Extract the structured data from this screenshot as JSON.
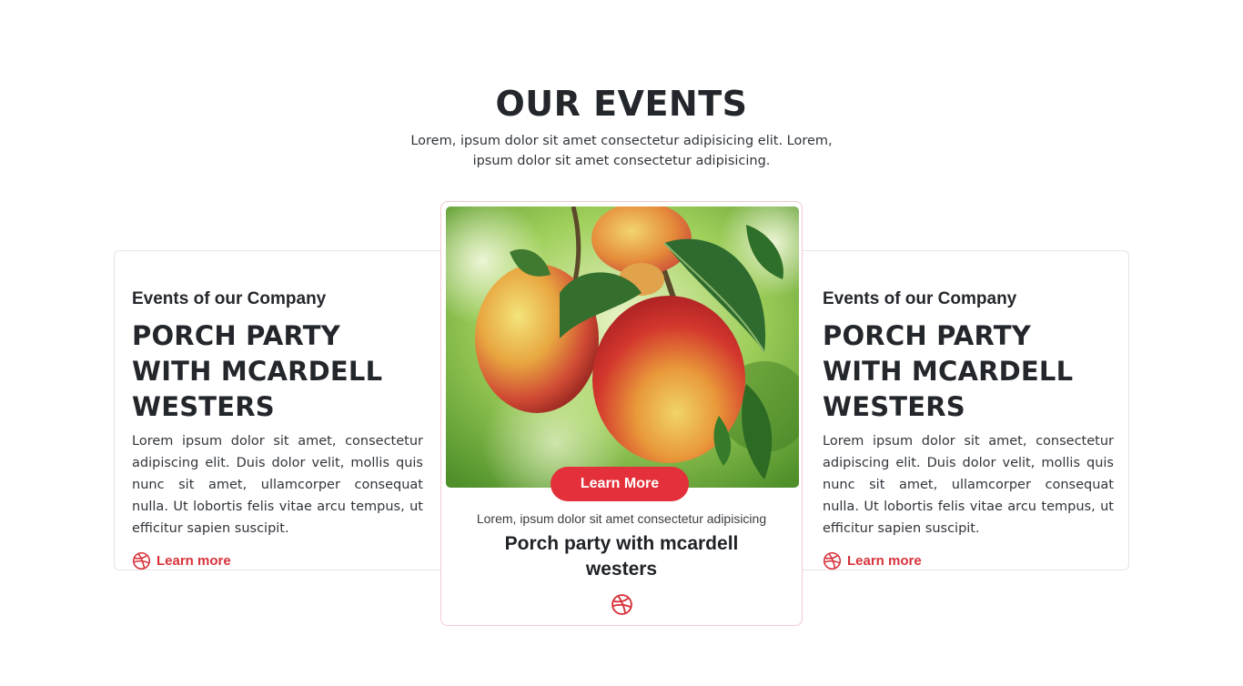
{
  "section": {
    "title": "OUR EVENTS",
    "subtitle": "Lorem, ipsum dolor sit amet consectetur adipisicing elit. Lorem, ipsum dolor sit amet consectetur adipisicing."
  },
  "left_card": {
    "kicker": "Events of our Company",
    "title": "PORCH PARTY WITH MCARDELL WESTERS",
    "description": "Lorem ipsum dolor sit amet, consectetur adipiscing elit. Duis dolor velit, mollis quis nunc sit amet, ullamcorper consequat nulla. Ut lobortis felis vitae arcu tempus, ut efficitur sapien suscipit.",
    "link_label": "Learn more",
    "link_icon": "dribbble-icon"
  },
  "center_card": {
    "image": "apples-on-branch",
    "button_label": "Learn More",
    "caption": "Lorem, ipsum dolor sit amet consectetur adipisicing",
    "title": "Porch party with mcardell westers",
    "icon": "dribbble-icon"
  },
  "right_card": {
    "kicker": "Events of our Company",
    "title": "PORCH PARTY WITH MCARDELL WESTERS",
    "description": "Lorem ipsum dolor sit amet, consectetur adipiscing elit. Duis dolor velit, mollis quis nunc sit amet, ullamcorper consequat nulla. Ut lobortis felis vitae arcu tempus, ut efficitur sapien suscipit.",
    "link_label": "Learn more",
    "link_icon": "dribbble-icon"
  },
  "colors": {
    "accent": "#e4303a",
    "heading": "#23262b",
    "border": "#e5e5e8"
  }
}
